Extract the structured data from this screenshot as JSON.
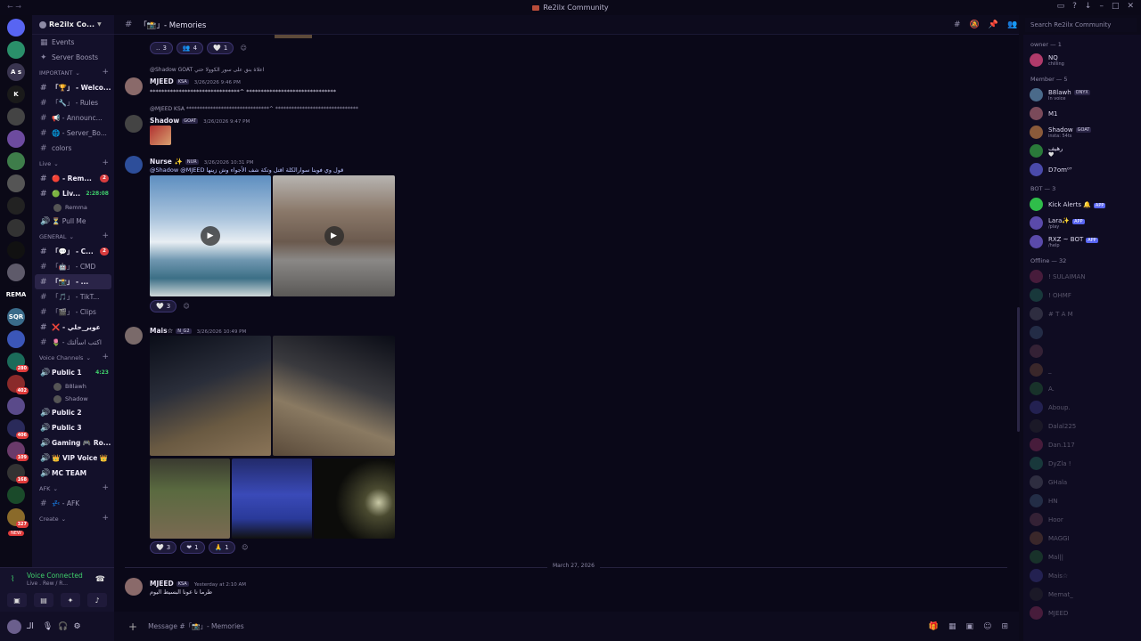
{
  "window": {
    "title": "Re2ilx Community"
  },
  "server": {
    "name": "Re2ilx Co...",
    "search_placeholder": "Search Re2ilx Community"
  },
  "guilds": [
    {
      "label": "",
      "color": "#5865f2",
      "badge": ""
    },
    {
      "label": "",
      "color": "#2a8f6a",
      "badge": ""
    },
    {
      "label": "A s",
      "color": "#3a3550",
      "badge": ""
    },
    {
      "label": "K",
      "color": "#1a1a1a",
      "badge": ""
    },
    {
      "label": "",
      "color": "#444",
      "badge": ""
    },
    {
      "label": "",
      "color": "#6d4b9f",
      "badge": ""
    },
    {
      "label": "",
      "color": "#3e7d4a",
      "badge": ""
    },
    {
      "label": "",
      "color": "#555",
      "badge": ""
    },
    {
      "label": "",
      "color": "#222",
      "badge": ""
    },
    {
      "label": "",
      "color": "#333",
      "badge": ""
    },
    {
      "label": "",
      "color": "#111",
      "badge": ""
    },
    {
      "label": "",
      "color": "#5e5a6a",
      "badge": ""
    },
    {
      "label": "REMA",
      "color": "#0b0917",
      "badge": ""
    },
    {
      "label": "SQR",
      "color": "#3a6b8a",
      "badge": ""
    },
    {
      "label": "",
      "color": "#3b56b8",
      "badge": ""
    },
    {
      "label": "",
      "color": "#1b6b5a",
      "badge": "280"
    },
    {
      "label": "",
      "color": "#8a2a2a",
      "badge": "402"
    },
    {
      "label": "",
      "color": "#5a4a8a",
      "badge": ""
    },
    {
      "label": "",
      "color": "#2a2a5a",
      "badge": "406"
    },
    {
      "label": "",
      "color": "#6a3a6a",
      "badge": "109"
    },
    {
      "label": "",
      "color": "#333",
      "badge": "168"
    },
    {
      "label": "",
      "color": "#1a4a2a",
      "badge": ""
    },
    {
      "label": "",
      "color": "#8a6a2a",
      "badge": "327"
    }
  ],
  "guild_new_badge": "NEW",
  "sidebar": {
    "top_items": [
      {
        "icon": "calendar-icon",
        "label": "Events"
      },
      {
        "icon": "boost-icon",
        "label": "Server Boosts"
      }
    ],
    "categories": [
      {
        "name": "IMPORTANT",
        "channels": [
          {
            "label": "「🏆」 - Welco...",
            "bold": true,
            "badge": ""
          },
          {
            "label": "「🔧」 - Rules",
            "bold": false,
            "badge": ""
          },
          {
            "label": "📢 - Announc...",
            "bold": false,
            "badge": ""
          },
          {
            "label": "🌐 - Server_Bo...",
            "bold": false,
            "badge": ""
          },
          {
            "label": "colors",
            "bold": false,
            "badge": ""
          }
        ]
      },
      {
        "name": "Live",
        "channels": [
          {
            "label": "🔴 - Rem...",
            "bold": true,
            "badge": "2"
          },
          {
            "label": "🟢 Liv...",
            "bold": true,
            "badge": "",
            "time": "2:28:08"
          },
          {
            "label": "Remma",
            "bold": true,
            "badge": "",
            "sub": true
          },
          {
            "label": "⏳ Pull Me",
            "bold": false,
            "badge": ""
          }
        ]
      },
      {
        "name": "GENERAL",
        "channels": [
          {
            "label": "「💬」 - C...",
            "bold": true,
            "badge": "2"
          },
          {
            "label": "「🤖」 - CMD",
            "bold": false,
            "badge": ""
          },
          {
            "label": "「📸」 - ...",
            "bold": true,
            "badge": "",
            "active": true
          },
          {
            "label": "「🎵」 - TikT...",
            "bold": false,
            "badge": ""
          },
          {
            "label": "「🎬」 - Clips",
            "bold": false,
            "badge": ""
          },
          {
            "label": "❌ - عوير_حلي",
            "bold": true,
            "badge": ""
          },
          {
            "label": "🌷 - اكتب اسألتك",
            "bold": false,
            "badge": ""
          }
        ]
      },
      {
        "name": "Voice Channels",
        "channels": [
          {
            "label": "Public 1",
            "bold": true,
            "badge": "",
            "time": "4:23"
          },
          {
            "label": "B8lawh",
            "bold": false,
            "badge": "",
            "sub": true
          },
          {
            "label": "Shadow",
            "bold": false,
            "badge": "",
            "sub": true
          },
          {
            "label": "Public 2",
            "bold": true,
            "badge": ""
          },
          {
            "label": "Public 3",
            "bold": true,
            "badge": ""
          },
          {
            "label": "Gaming 🎮 Ro...",
            "bold": true,
            "badge": ""
          },
          {
            "label": "👑 VIP Voice 👑",
            "bold": true,
            "badge": ""
          },
          {
            "label": "MC TEAM",
            "bold": true,
            "badge": ""
          }
        ]
      },
      {
        "name": "AFK",
        "channels": [
          {
            "label": "💤 - AFK",
            "bold": false,
            "badge": ""
          }
        ]
      },
      {
        "name": "Create",
        "channels": []
      }
    ]
  },
  "voice_panel": {
    "title": "Voice Connected",
    "subtitle": "Live . Rew / R..."
  },
  "user_panel": {
    "name": "الـ"
  },
  "header": {
    "channel": "「📸」- Memories"
  },
  "messages": [
    {
      "author": "MJEED",
      "tag": "KSA",
      "time": "3/26/2026 9:46 PM",
      "reply": "@Shadow GOAT اعلاة بنق على سور الكوولا حتي",
      "text": "*******************************^ *******************************"
    },
    {
      "author": "Shadow",
      "tag": "GOAT",
      "time": "3/26/2026 9:47 PM",
      "reply": "@MJEED KSA *******************************^ *******************************",
      "text": ""
    },
    {
      "author": "Nurse ✨",
      "tag": "NUR",
      "time": "3/26/2026 10:31 PM",
      "reply": "",
      "text": "@Shadow @MJEED قول وي فوينا سوارالكلة اقتل وتكة شف الأجواء وش زينها"
    },
    {
      "author": "Mais☆",
      "tag": "N_G2",
      "time": "3/26/2026 10:49 PM",
      "reply": "",
      "text": ""
    },
    {
      "author": "MJEED",
      "tag": "KSA",
      "time": "Yesterday at 2:10 AM",
      "reply": "",
      "text": "طرما نا عونا البسيط اليوم"
    }
  ],
  "reactions": {
    "row1": [
      {
        "emoji": "..",
        "count": "3"
      },
      {
        "emoji": "👥",
        "count": "4"
      },
      {
        "emoji": "🤍",
        "count": "1"
      }
    ],
    "row2": [
      {
        "emoji": "🤍",
        "count": "3"
      }
    ],
    "row3": [
      {
        "emoji": "🤍",
        "count": "3"
      },
      {
        "emoji": "❤",
        "count": "1"
      },
      {
        "emoji": "🙏",
        "count": "1"
      }
    ]
  },
  "date_divider": "March 27, 2026",
  "composer": {
    "placeholder": "Message #「📸」- Memories"
  },
  "members": {
    "groups": [
      {
        "name": "owner — 1",
        "items": [
          {
            "name": "NQ",
            "status": "chilling",
            "bot": false
          }
        ]
      },
      {
        "name": "Member — 5",
        "items": [
          {
            "name": "B8lawh",
            "status": "In voice",
            "tag": "ONYX",
            "bot": false
          },
          {
            "name": "M1",
            "status": "",
            "bot": false
          },
          {
            "name": "Shadow",
            "status": "insta: 54ts",
            "tag": "GOAT",
            "bot": false
          },
          {
            "name": "رهيف",
            "status": "🤍",
            "bot": false
          },
          {
            "name": "D7om⁰⁷",
            "status": "",
            "bot": false
          }
        ]
      },
      {
        "name": "BOT — 3",
        "items": [
          {
            "name": "Kick Alerts 🔔",
            "status": "",
            "bot": true
          },
          {
            "name": "Lara✨",
            "status": "/play",
            "bot": true
          },
          {
            "name": "RXZ ~ BOT",
            "status": "/help",
            "bot": true
          }
        ]
      },
      {
        "name": "Offline — 32",
        "items": [
          {
            "name": "! SULAIMAN",
            "status": "",
            "off": true
          },
          {
            "name": "! OHMF",
            "status": "",
            "off": true
          },
          {
            "name": "# T A M",
            "status": "",
            "off": true
          },
          {
            "name": "",
            "status": "",
            "off": true
          },
          {
            "name": "",
            "status": "",
            "off": true
          },
          {
            "name": "_",
            "status": "",
            "off": true
          },
          {
            "name": "A.",
            "status": "",
            "off": true
          },
          {
            "name": "Aboup.",
            "status": "",
            "off": true
          },
          {
            "name": "Dalal225",
            "status": "",
            "off": true
          },
          {
            "name": "Dan.117",
            "status": "",
            "off": true
          },
          {
            "name": "DyZla !",
            "status": "",
            "off": true
          },
          {
            "name": "GHala",
            "status": "",
            "off": true
          },
          {
            "name": "HN",
            "status": "",
            "off": true
          },
          {
            "name": "Hoor",
            "status": "",
            "off": true
          },
          {
            "name": "MAGGI",
            "status": "",
            "off": true
          },
          {
            "name": "Mal||",
            "status": "",
            "off": true
          },
          {
            "name": "Mais☆",
            "status": "",
            "off": true
          },
          {
            "name": "Memat_",
            "status": "",
            "off": true
          },
          {
            "name": "MJEED",
            "status": "",
            "off": true
          }
        ]
      }
    ],
    "bot_badge": "APP"
  }
}
